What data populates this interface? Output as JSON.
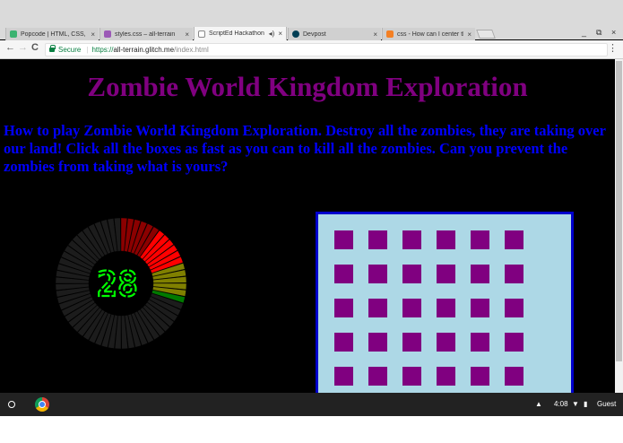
{
  "tabs": [
    {
      "title": "Popcode | HTML, CSS, a",
      "favicon_color": "#3cb371"
    },
    {
      "title": "styles.css – all-terrain",
      "favicon_color": "#9b59b6"
    },
    {
      "title": "ScriptEd Hackathon",
      "favicon_color": "#ffffff"
    },
    {
      "title": "Devpost",
      "favicon_color": "#003e54"
    },
    {
      "title": "css - How can I center th",
      "favicon_color": "#f48024"
    }
  ],
  "close_glyph": "×",
  "window_controls": {
    "minimize": "_",
    "restore": "⧉",
    "close": "×"
  },
  "nav": {
    "back": "←",
    "forward": "→",
    "reload": "C",
    "menu": "⋮"
  },
  "omnibox": {
    "secure_label": "Secure",
    "separator": "|",
    "scheme": "https://",
    "host": "all-terrain.glitch.me",
    "path": "/index.html"
  },
  "page": {
    "title": "Zombie World Kingdom Exploration",
    "instructions": "How to play Zombie World Kingdom Exploration. Destroy all the zombies, they are taking over our land! Click all the boxes as fast as you can to kill all the zombies. Can you prevent the zombies from taking what is yours?",
    "timer_value": "28",
    "timer_fraction_remaining": 0.3,
    "colors": {
      "title": "#800080",
      "instructions": "#0000ff",
      "box": "#800080",
      "game_bg": "#add8e6",
      "game_border": "#0000cd"
    },
    "game_grid": {
      "rows": 5,
      "cols": 6
    }
  },
  "shelf": {
    "time": "4:08",
    "user": "Guest",
    "icons": [
      "launcher-icon",
      "chrome-icon",
      "notification-icon",
      "wifi-icon",
      "battery-icon"
    ]
  }
}
